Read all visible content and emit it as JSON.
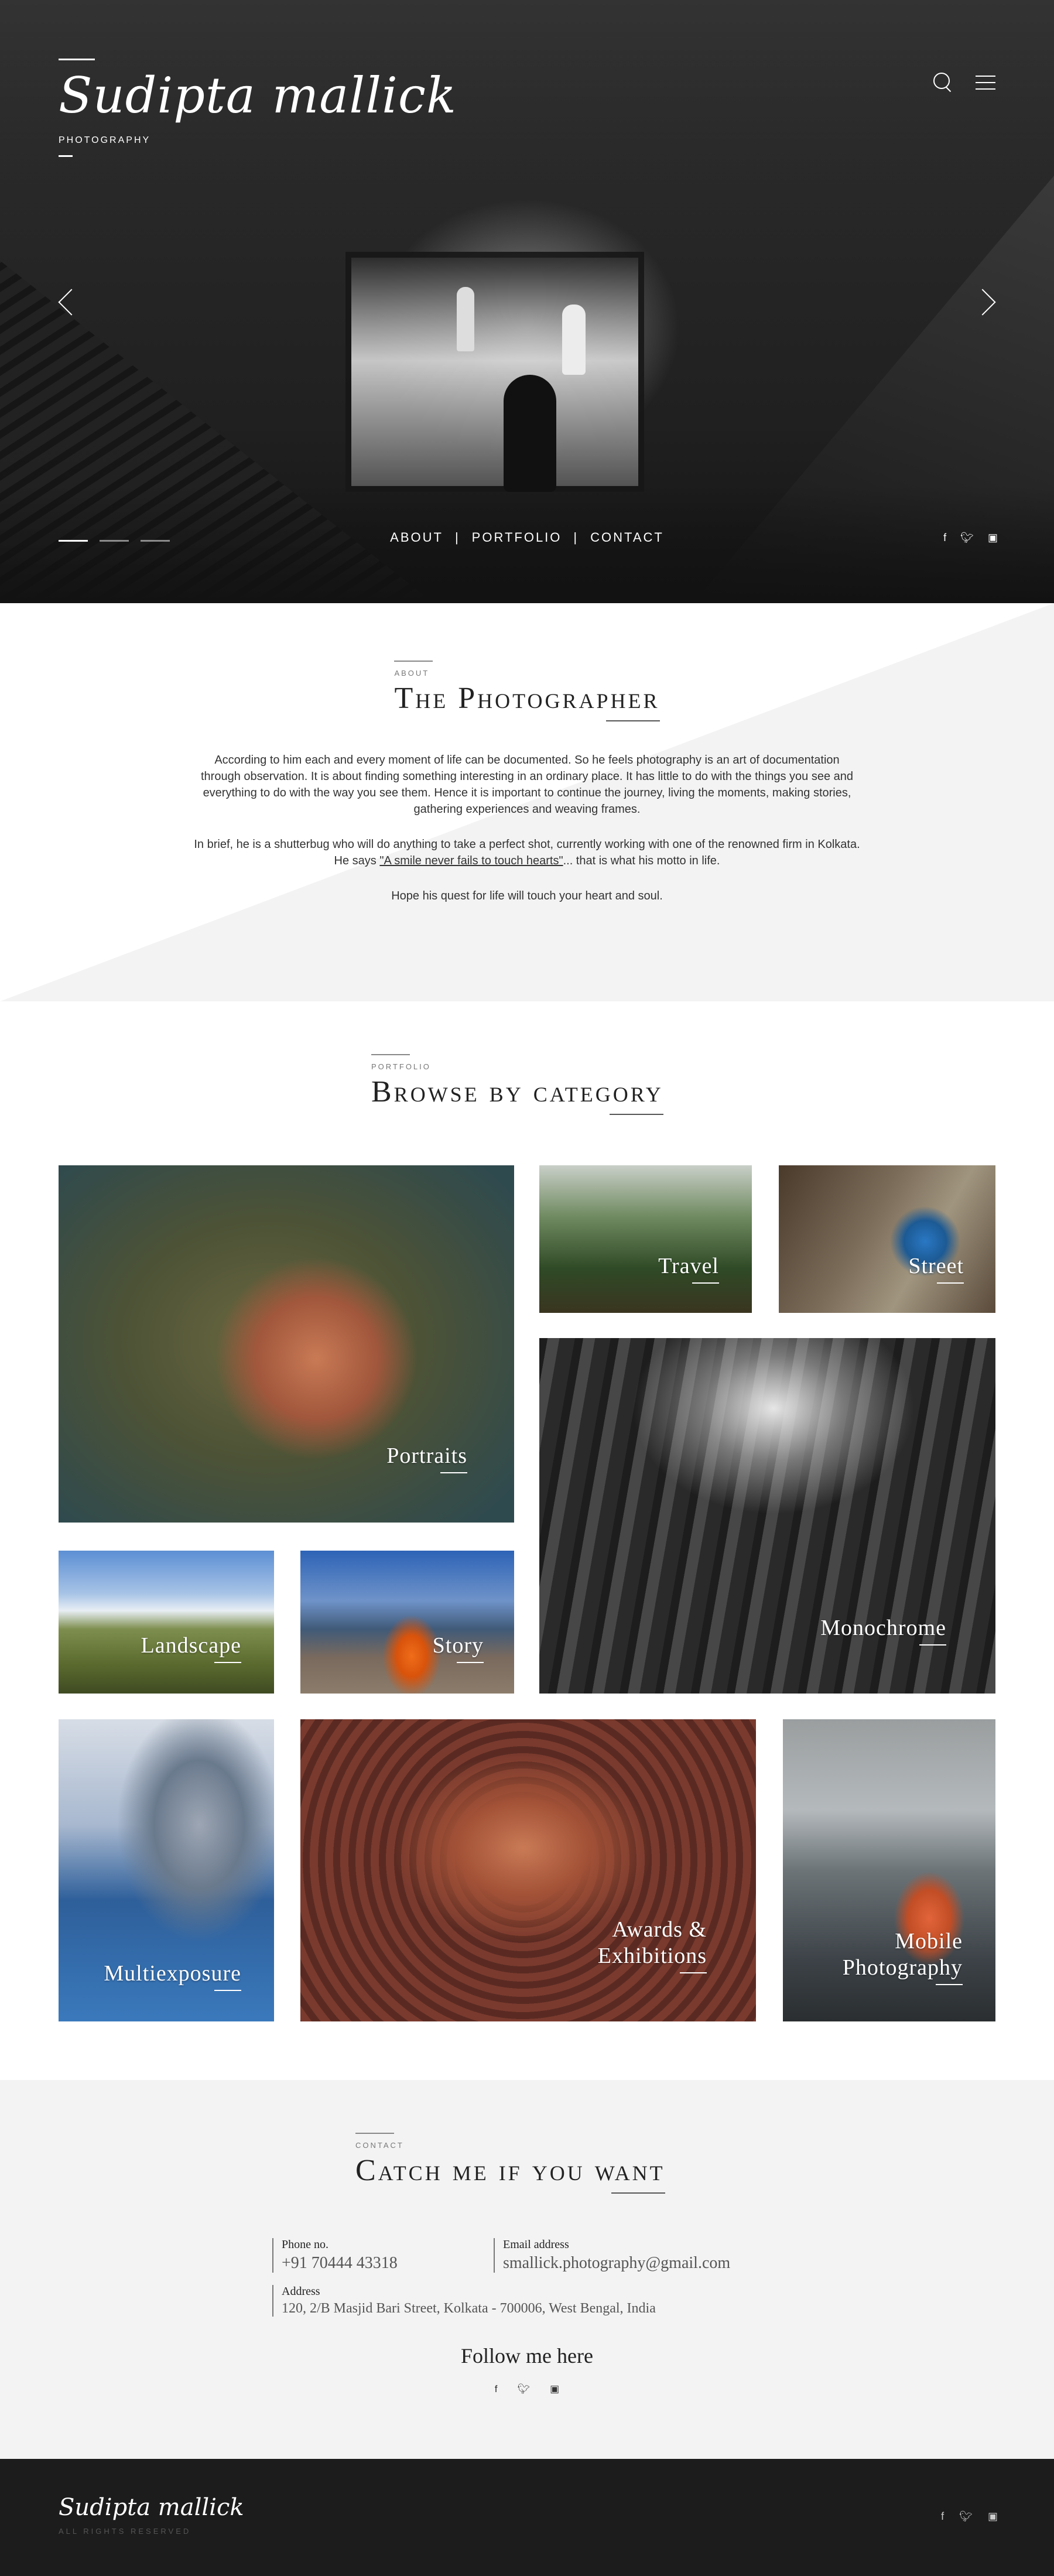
{
  "hero": {
    "logo": "Sudipta mallick",
    "logo_sub": "PHOTOGRAPHY",
    "nav": [
      "ABOUT",
      "PORTFOLIO",
      "CONTACT"
    ],
    "separator": "|",
    "social": [
      "f",
      "t",
      "ig"
    ],
    "slides_total": 3,
    "slide_active": 1
  },
  "about": {
    "kicker": "ABOUT",
    "title": "The Photographer",
    "p1": "According to him each and every moment of life can be documented. So he feels photography is an art of documentation through observation. It is about finding something interesting in an ordinary place. It has little to do with the things you see and everything to do with the way you see them. Hence it is important to continue the journey, living the moments, making stories, gathering experiences and weaving frames.",
    "p2_before": "In brief, he is a shutterbug who will do anything to take a perfect shot, currently working with one of the renowned firm in Kolkata. He says ",
    "p2_link": "\"A smile never fails to touch hearts\"",
    "p2_after": "... that is what his motto in life.",
    "p3": "Hope his quest for life will touch your heart and soul."
  },
  "portfolio": {
    "kicker": "PORTFOLIO",
    "title": "Browse by category",
    "categories": {
      "portraits": "Portraits",
      "travel": "Travel",
      "street": "Street",
      "monochrome": "Monochrome",
      "landscape": "Landscape",
      "story": "Story",
      "multiexposure": "Multiexposure",
      "awards_line1": "Awards &",
      "awards_line2": "Exhibitions",
      "mobile_line1": "Mobile",
      "mobile_line2": "Photography"
    }
  },
  "contact": {
    "kicker": "CONTACT",
    "title": "Catch me if you want",
    "phone_label": "Phone no.",
    "phone": "+91 70444 43318",
    "email_label": "Email address",
    "email": "smallick.photography@gmail.com",
    "address_label": "Address",
    "address": "120, 2/B Masjid Bari Street, Kolkata - 700006, West Bengal, India",
    "follow": "Follow me here",
    "social": [
      "f",
      "t",
      "ig"
    ]
  },
  "footer": {
    "logo": "Sudipta mallick",
    "rights": "ALL RIGHTS RESERVED",
    "social": [
      "f",
      "t",
      "ig"
    ]
  },
  "colors": {
    "hero_bg": "#1c1c1c",
    "section_grey": "#f3f3f3",
    "footer_bg": "#1c1c1d"
  }
}
